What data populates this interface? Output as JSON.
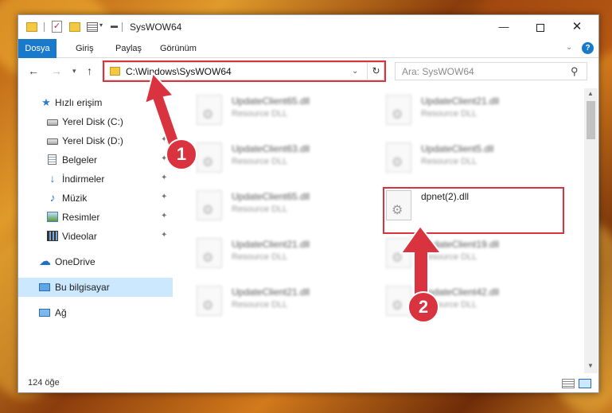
{
  "window": {
    "title": "SysWOW64"
  },
  "ribbon": {
    "tabs": [
      {
        "label": "Dosya"
      },
      {
        "label": "Giriş"
      },
      {
        "label": "Paylaş"
      },
      {
        "label": "Görünüm"
      }
    ]
  },
  "address": {
    "path": "C:\\Windows\\SysWOW64"
  },
  "search": {
    "placeholder": "Ara: SysWOW64"
  },
  "sidebar": {
    "items": [
      {
        "label": "Hızlı erişim",
        "icon": "star-icon"
      },
      {
        "label": "Yerel Disk (C:)",
        "icon": "drive-icon"
      },
      {
        "label": "Yerel Disk (D:)",
        "icon": "drive-icon"
      },
      {
        "label": "Belgeler",
        "icon": "documents-icon"
      },
      {
        "label": "İndirmeler",
        "icon": "download-icon"
      },
      {
        "label": "Müzik",
        "icon": "music-icon"
      },
      {
        "label": "Resimler",
        "icon": "pictures-icon"
      },
      {
        "label": "Videolar",
        "icon": "videos-icon"
      },
      {
        "label": "OneDrive",
        "icon": "cloud-icon"
      },
      {
        "label": "Bu bilgisayar",
        "icon": "computer-icon",
        "selected": true
      },
      {
        "label": "Ağ",
        "icon": "network-icon"
      }
    ]
  },
  "files": [
    {
      "name": "UpdateClient65.dll",
      "type": "Resource DLL"
    },
    {
      "name": "UpdateClient21.dll",
      "type": "Resource DLL"
    },
    {
      "name": "UpdateClient63.dll",
      "type": "Resource DLL"
    },
    {
      "name": "UpdateClient5.dll",
      "type": "Resource DLL"
    },
    {
      "name": "UpdateClient65.dll",
      "type": "Resource DLL"
    },
    {
      "name": "dpnet(2).dll",
      "type": ""
    },
    {
      "name": "UpdateClient21.dll",
      "type": "Resource DLL"
    },
    {
      "name": "UpdateClient19.dll",
      "type": "Resource DLL"
    },
    {
      "name": "UpdateClient21.dll",
      "type": "Resource DLL"
    },
    {
      "name": "UpdateClient42.dll",
      "type": "Resource DLL"
    }
  ],
  "status": {
    "count": "124 öğe"
  },
  "annotations": {
    "step1": "1",
    "step2": "2"
  },
  "colors": {
    "accent": "#1979ca",
    "highlight": "#d9333f",
    "selection": "#cce8ff"
  }
}
